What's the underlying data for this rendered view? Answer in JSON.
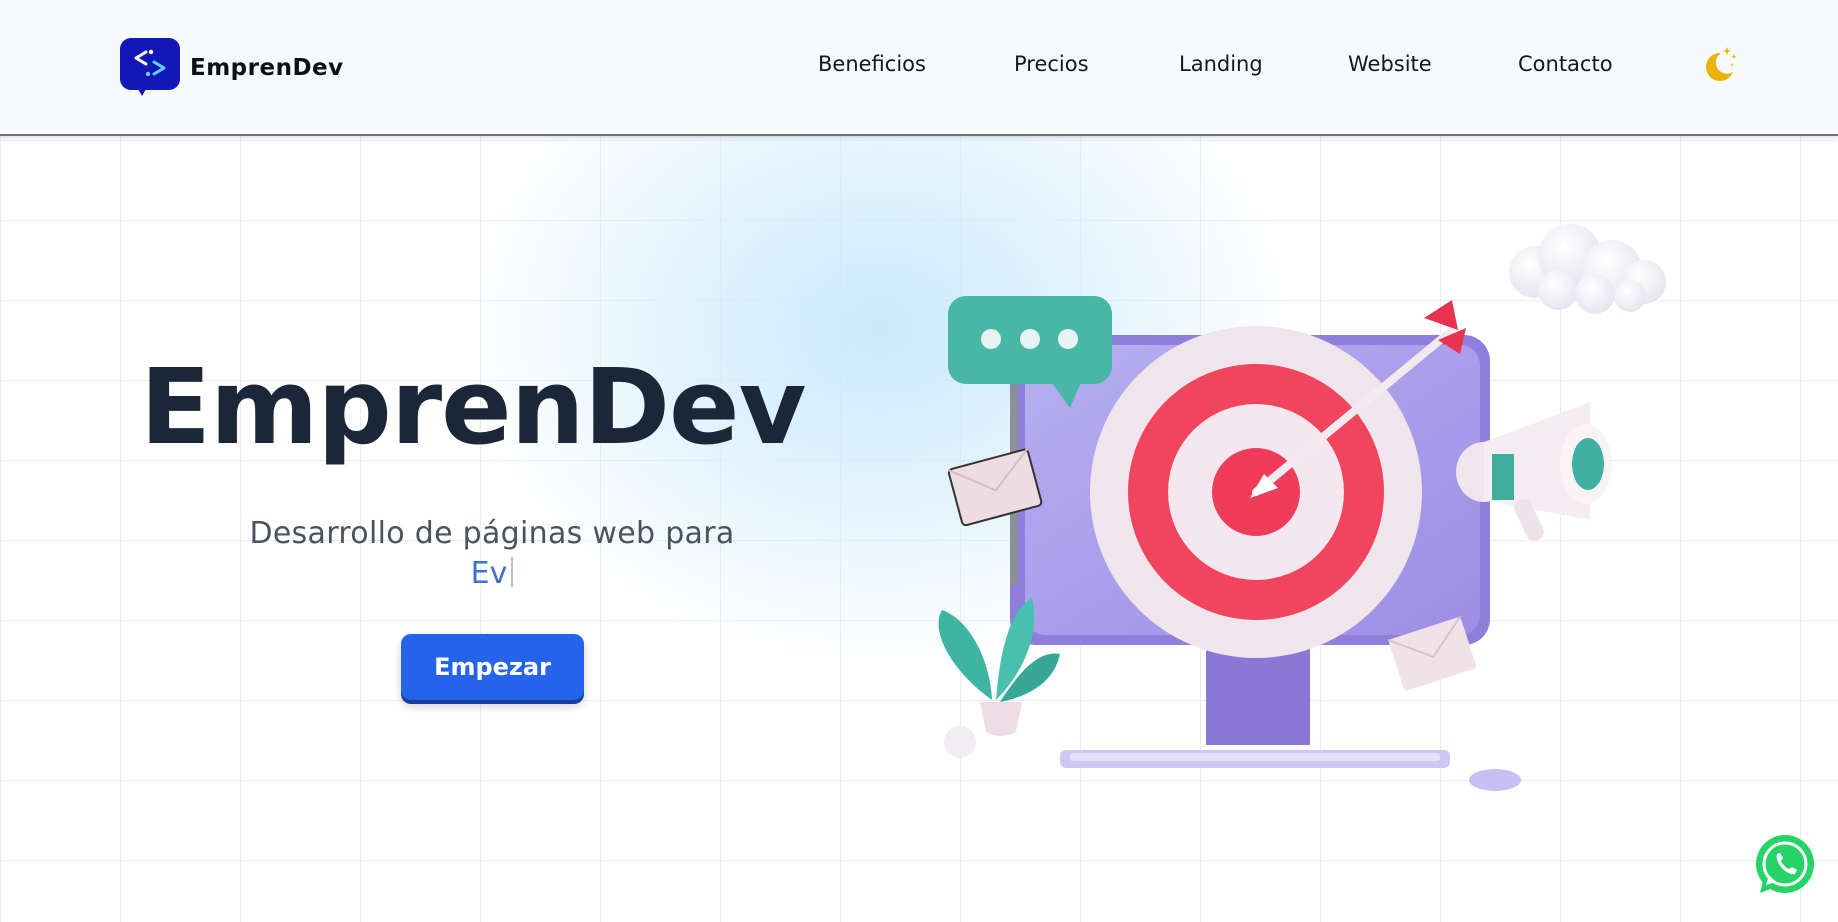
{
  "header": {
    "brand": "EmprenDev",
    "nav": [
      {
        "label": "Beneficios"
      },
      {
        "label": "Precios"
      },
      {
        "label": "Landing"
      },
      {
        "label": "Website"
      },
      {
        "label": "Contacto"
      }
    ],
    "theme_icon": "moon-stars-icon"
  },
  "hero": {
    "title": "EmprenDev",
    "subtitle": "Desarrollo de páginas web para",
    "typed_text": "Ev",
    "cta_label": "Empezar"
  },
  "floating": {
    "whatsapp_icon": "whatsapp-icon"
  },
  "colors": {
    "brand": "#1317b8",
    "cta": "#2563eb",
    "title": "#1c2639",
    "typed": "#3e6ed6",
    "moon": "#eab308",
    "whatsapp": "#25d366"
  }
}
